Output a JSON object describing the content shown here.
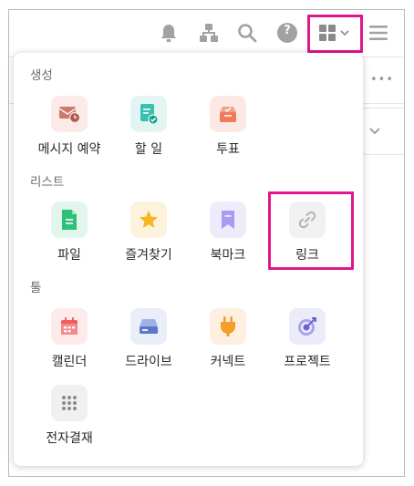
{
  "toolbar": {
    "icons": [
      "bell-icon",
      "org-chart-icon",
      "search-icon",
      "help-icon",
      "apps-grid-icon",
      "chevron-down-icon",
      "menu-icon"
    ],
    "help_label": "?"
  },
  "background": {
    "more_label": "•••"
  },
  "menu": {
    "sections": [
      {
        "title": "생성",
        "items": [
          {
            "label": "메시지 예약",
            "icon": "scheduled-message-icon",
            "bg": "#fbeae8",
            "accent": "#c9796d"
          },
          {
            "label": "할 일",
            "icon": "todo-icon",
            "bg": "#e3f5f3",
            "accent": "#3bbfae"
          },
          {
            "label": "투표",
            "icon": "vote-icon",
            "bg": "#fde9e4",
            "accent": "#f07a5c"
          }
        ]
      },
      {
        "title": "리스트",
        "items": [
          {
            "label": "파일",
            "icon": "file-icon",
            "bg": "#e2f6ec",
            "accent": "#2fbf78"
          },
          {
            "label": "즐겨찾기",
            "icon": "star-icon",
            "bg": "#fdf3dc",
            "accent": "#f5b823"
          },
          {
            "label": "북마크",
            "icon": "bookmark-icon",
            "bg": "#eeebfb",
            "accent": "#a79cf0"
          },
          {
            "label": "링크",
            "icon": "link-icon",
            "bg": "#f1f1f1",
            "accent": "#b3b3b3"
          }
        ]
      },
      {
        "title": "툴",
        "items": [
          {
            "label": "캘린더",
            "icon": "calendar-icon",
            "bg": "#fdeaea",
            "accent": "#ef5d5d"
          },
          {
            "label": "드라이브",
            "icon": "drive-icon",
            "bg": "#e9eef9",
            "accent": "#5b78c9"
          },
          {
            "label": "커넥트",
            "icon": "connect-plug-icon",
            "bg": "#fdf0e0",
            "accent": "#f49d2a"
          },
          {
            "label": "프로젝트",
            "icon": "project-target-icon",
            "bg": "#ecebfa",
            "accent": "#6b63d9"
          },
          {
            "label": "전자결재",
            "icon": "approval-dots-icon",
            "bg": "#f0f0f0",
            "accent": "#8c8c8c"
          }
        ]
      }
    ]
  },
  "highlight_color": "#e0168c"
}
